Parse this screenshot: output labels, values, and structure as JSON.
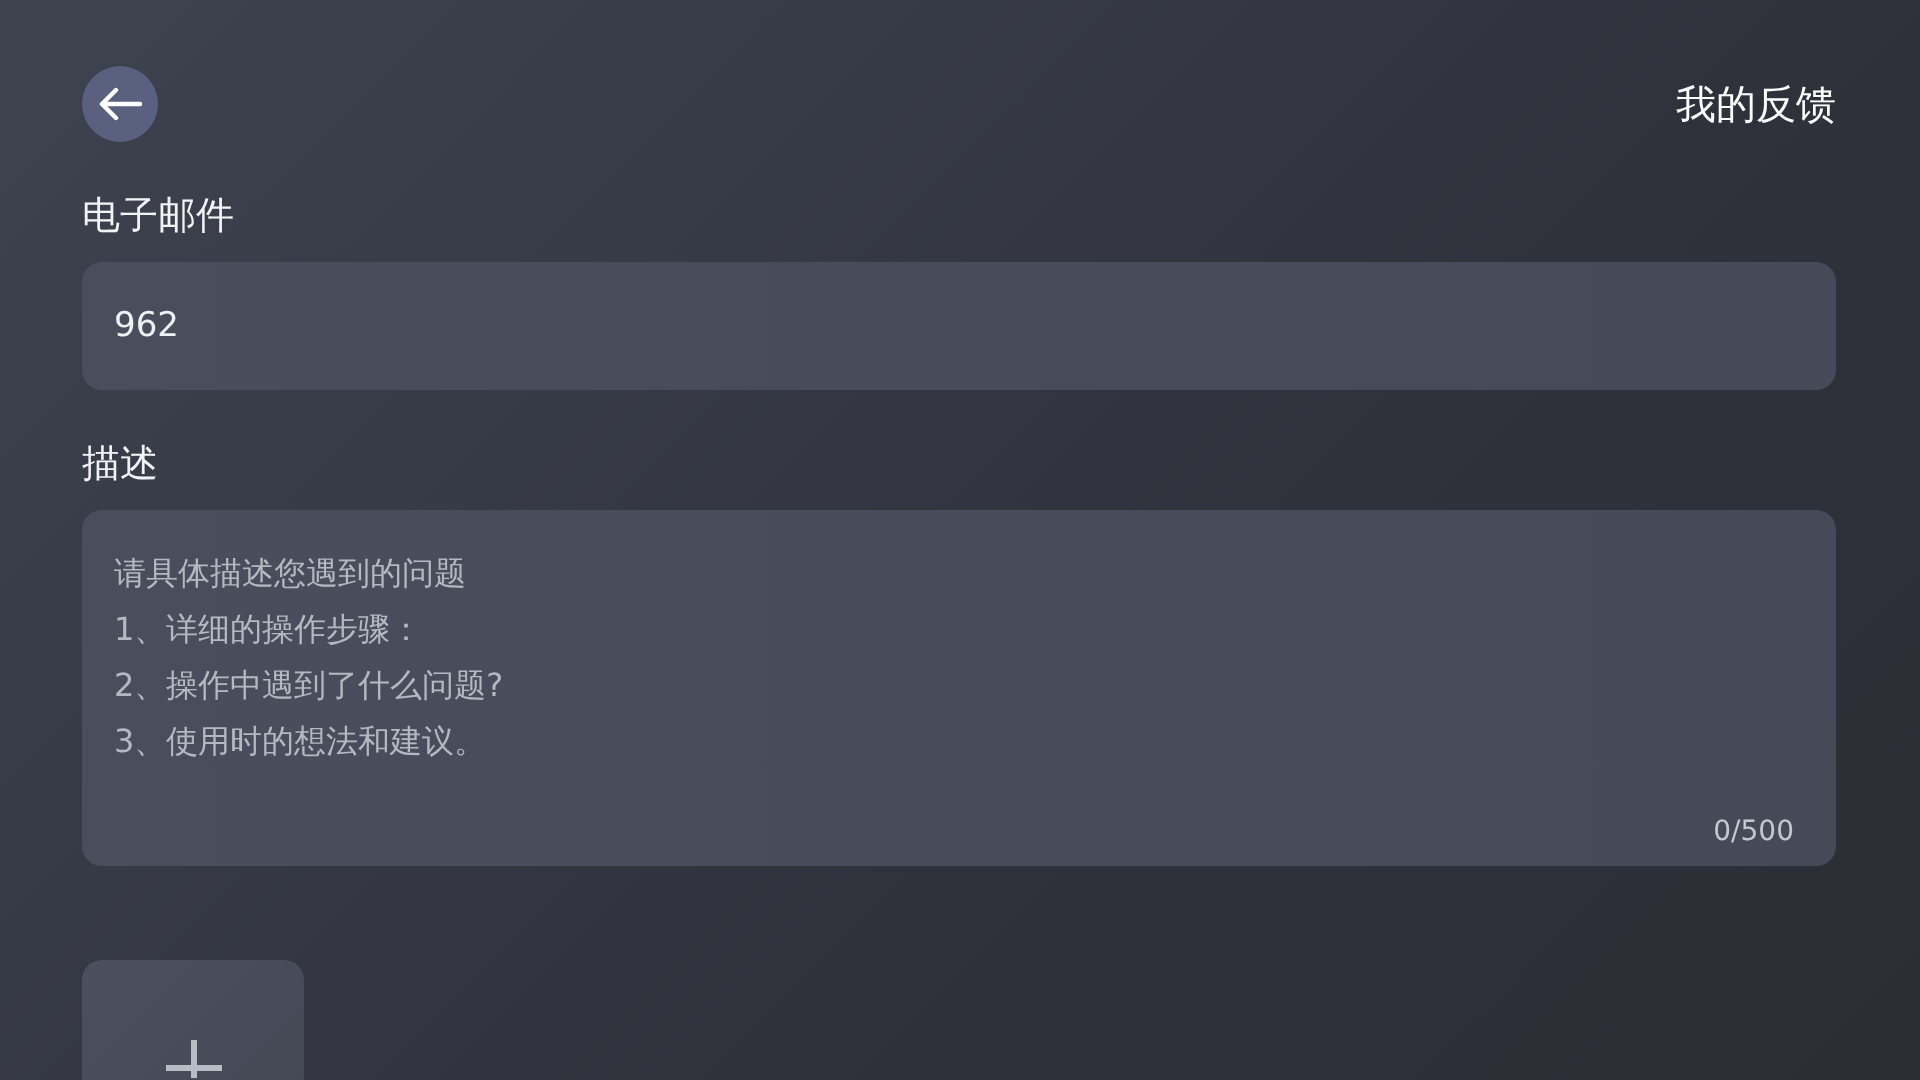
{
  "header": {
    "title": "我的反馈"
  },
  "email": {
    "label": "电子邮件",
    "value": "962"
  },
  "description": {
    "label": "描述",
    "placeholder": "请具体描述您遇到的问题\n1、详细的操作步骤：\n2、操作中遇到了什么问题?\n3、使用时的想法和建议。",
    "counter": "0/500"
  },
  "attachments": [
    {
      "kind": "add"
    }
  ]
}
